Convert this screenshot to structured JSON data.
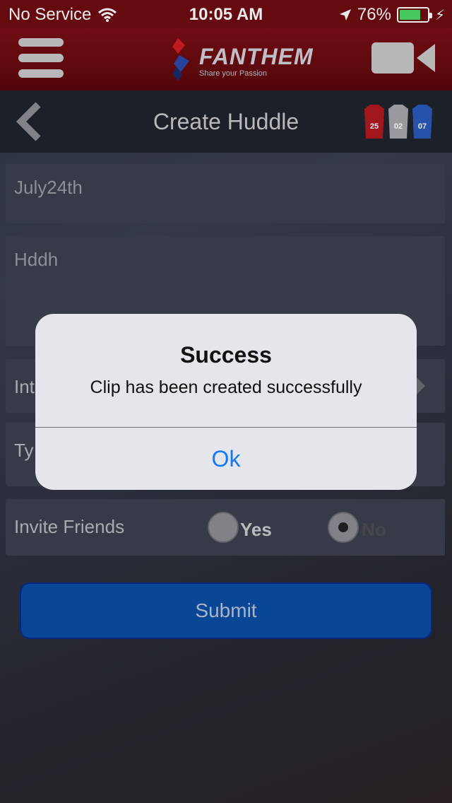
{
  "status_bar": {
    "carrier": "No Service",
    "time": "10:05 AM",
    "battery_percent": "76%",
    "battery_level": 0.76
  },
  "header": {
    "logo_text": "FANTHEM",
    "logo_tagline": "Share your Passion"
  },
  "nav": {
    "title": "Create Huddle",
    "jersey_numbers": [
      "25",
      "02",
      "07"
    ]
  },
  "form": {
    "name_value": "July24th",
    "description_value": "Hddh",
    "interest_label_visible": "Int",
    "type_label_visible": "Ty",
    "invite_friends_label": "Invite Friends",
    "option_yes": "Yes",
    "option_no": "No",
    "selected_option": "No",
    "submit_label": "Submit"
  },
  "alert": {
    "title": "Success",
    "message": "Clip has been created successfully",
    "ok_label": "Ok"
  },
  "colors": {
    "accent_red": "#6e0c12",
    "submit_blue": "#0a4da2",
    "ios_link_blue": "#1479f5"
  }
}
